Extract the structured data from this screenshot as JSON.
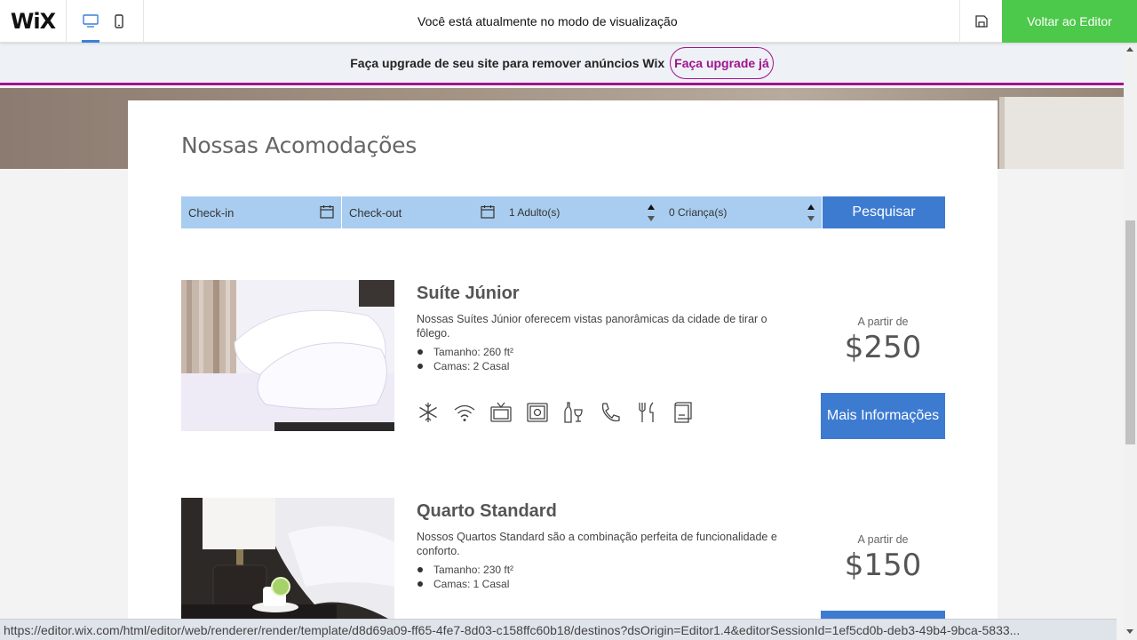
{
  "topbar": {
    "logo": "WiX",
    "desktop_icon": "desktop-icon",
    "mobile_icon": "mobile-icon",
    "mode_text": "Você está atualmente no modo de visualização",
    "save_icon": "save-icon",
    "back_button": "Voltar ao Editor",
    "accent_color": "#4cc84a"
  },
  "upgrade": {
    "text": "Faça upgrade de seu site para remover anúncios Wix",
    "button": "Faça upgrade já",
    "color": "#a0138e"
  },
  "page": {
    "heading": "Nossas Acomodações"
  },
  "search": {
    "checkin": "Check-in",
    "checkout": "Check-out",
    "adults": "1 Adulto(s)",
    "children": "0 Criança(s)",
    "button": "Pesquisar",
    "button_color": "#3d7bd1"
  },
  "rooms": [
    {
      "name": "Suíte Júnior",
      "description": "Nossas Suítes Júnior oferecem vistas panorâmicas da cidade de tirar o fôlego.",
      "features": [
        "Tamanho: 260 ft²",
        "Camas: 2 Casal"
      ],
      "amenities": [
        "snowflake-icon",
        "wifi-icon",
        "tv-icon",
        "safe-icon",
        "minibar-icon",
        "phone-icon",
        "restaurant-icon",
        "towel-icon"
      ],
      "from_label": "A partir de",
      "price": "$250",
      "button": "Mais Informações"
    },
    {
      "name": "Quarto Standard",
      "description": "Nossos Quartos Standard são a combinação perfeita de funcionalidade e conforto.",
      "features": [
        "Tamanho: 230 ft²",
        "Camas: 1 Casal"
      ],
      "from_label": "A partir de",
      "price": "$150"
    }
  ],
  "status_url": "https://editor.wix.com/html/editor/web/renderer/render/template/d8d69a09-ff65-4fe7-8d03-c158ffc60b18/destinos?dsOrigin=Editor1.4&editorSessionId=1ef5cd0b-deb3-49b4-9bca-5833..."
}
